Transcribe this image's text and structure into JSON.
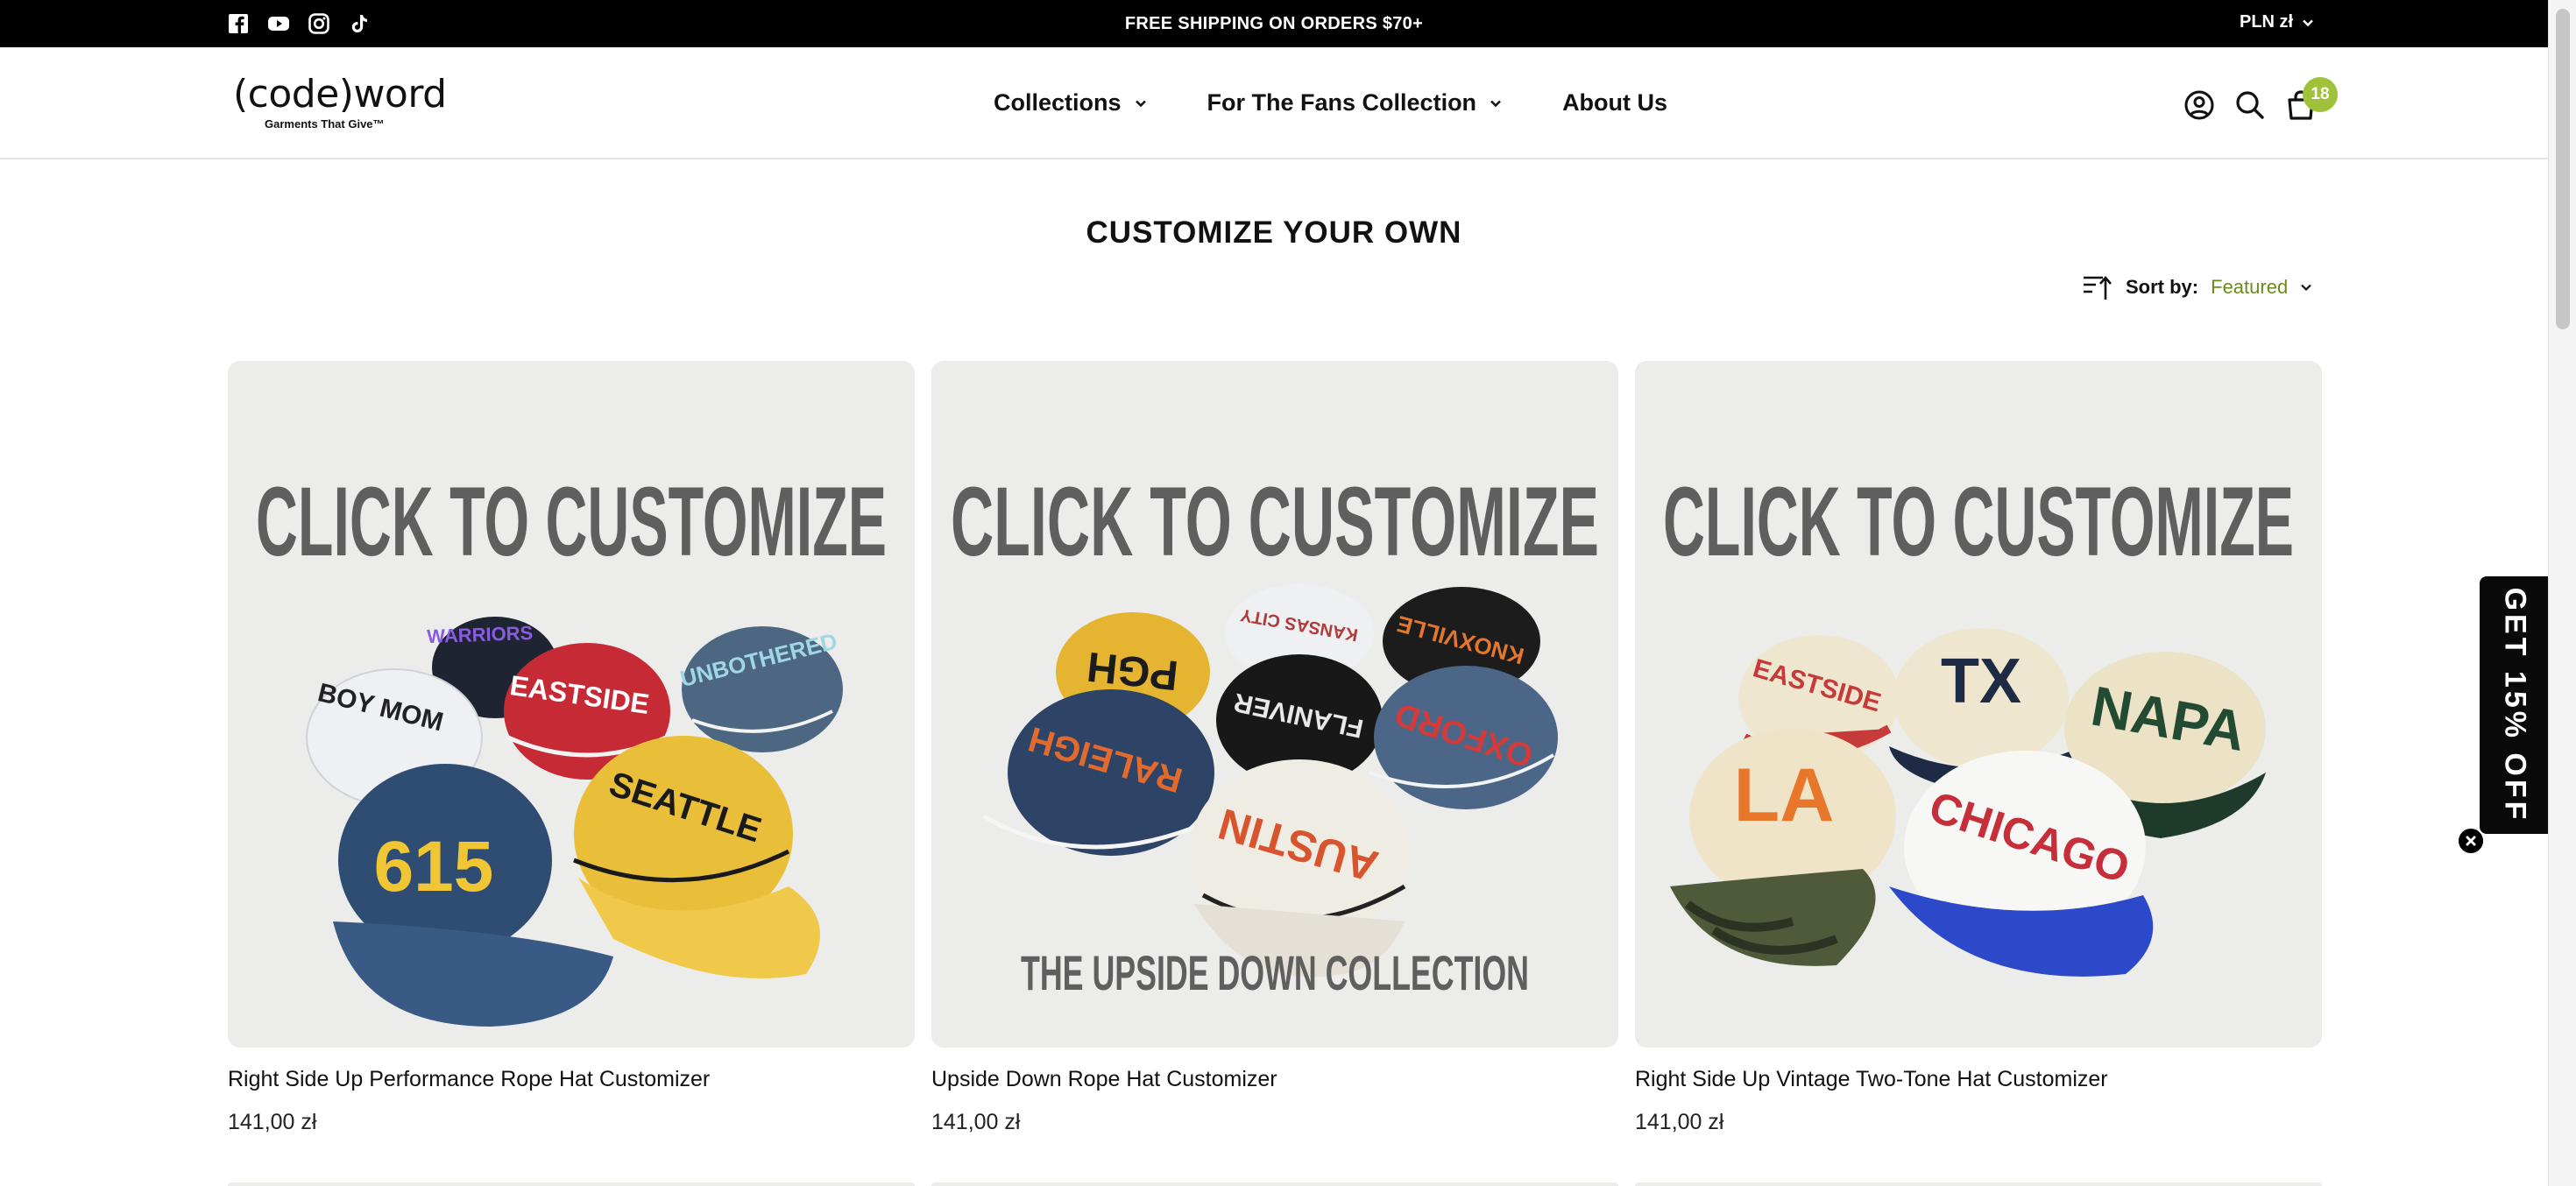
{
  "announcement": "FREE SHIPPING ON ORDERS $70+",
  "currency": "PLN zł",
  "social_icons": [
    "facebook-icon",
    "youtube-icon",
    "instagram-icon",
    "tiktok-icon"
  ],
  "logo": {
    "wordmark": "(code)word",
    "tagline": "Garments That Give™"
  },
  "nav": [
    {
      "label": "Collections",
      "has_dropdown": true
    },
    {
      "label": "For The Fans Collection",
      "has_dropdown": true
    },
    {
      "label": "About Us",
      "has_dropdown": false
    }
  ],
  "header_icons": [
    "account-icon",
    "search-icon",
    "cart-icon"
  ],
  "cart_count": "18",
  "page_title": "CUSTOMIZE YOUR OWN",
  "sort": {
    "label": "Sort by:",
    "value": "Featured"
  },
  "products": [
    {
      "name": "Right Side Up Performance Rope Hat Customizer",
      "price": "141,00 zł",
      "image_heading": "CLICK TO CUSTOMIZE",
      "hat_text": [
        "WARRIORS",
        "BOY MOM",
        "EASTSIDE",
        "UNBOTHERED",
        "615",
        "SEATTLE"
      ]
    },
    {
      "name": "Upside Down Rope Hat Customizer",
      "price": "141,00 zł",
      "image_heading": "CLICK TO CUSTOMIZE",
      "image_footer": "THE UPSIDE DOWN COLLECTION",
      "hat_text": [
        "PGH",
        "KANSAS CITY",
        "KNOXVILLE",
        "RALEIGH",
        "FLANIVER",
        "OXFORD",
        "AUSTIN"
      ]
    },
    {
      "name": "Right Side Up Vintage Two-Tone Hat Customizer",
      "price": "141,00 zł",
      "image_heading": "CLICK TO CUSTOMIZE",
      "hat_text": [
        "EASTSIDE",
        "TX",
        "NAPA",
        "LA",
        "CHICAGO"
      ]
    }
  ],
  "promo_tab": "GET 15% OFF",
  "colors": {
    "accent_green": "#a0c23a",
    "sort_value": "#6a8a1a",
    "topbar": "#000000",
    "image_bg": "#ececeb"
  }
}
